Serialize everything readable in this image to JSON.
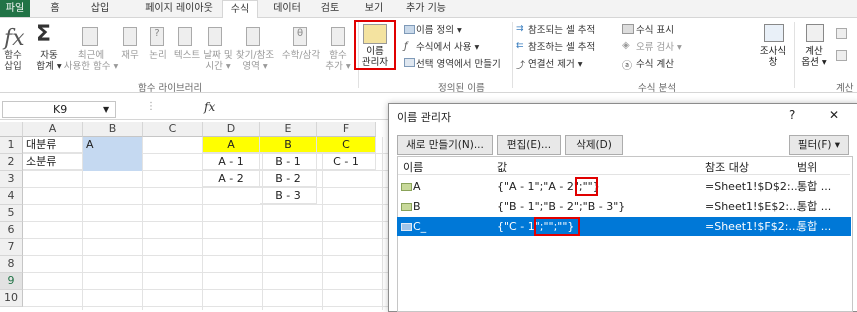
{
  "menu": {
    "tabs": [
      "파일",
      "홈",
      "삽입",
      "페이지 레이아웃",
      "수식",
      "데이터",
      "검토",
      "보기",
      "추가 기능"
    ]
  },
  "ribbon": {
    "insert_function": "함수\n삽입",
    "autosum": "자동\n합계 ▾",
    "recent": "최근에\n사용한 함수 ▾",
    "financial": "재무",
    "logical": "논리",
    "text": "텍스트",
    "datetime": "날짜 및\n시간 ▾",
    "lookup": "찾기/참조\n영역 ▾",
    "math": "수학/삼각",
    "more": "함수\n추가 ▾",
    "group_library": "함수 라이브러리",
    "name_manager": "이름\n관리자",
    "define_name": "이름 정의 ▾",
    "use_in_formula": "수식에서 사용 ▾",
    "create_from_selection": "선택 영역에서 만들기",
    "group_defined_names": "정의된 이름",
    "trace_precedents": "참조되는 셀 추적",
    "trace_dependents": "참조하는 셀 추적",
    "remove_arrows": "연결선 제거 ▾",
    "show_formulas": "수식 표시",
    "error_checking": "오류 검사 ▾",
    "evaluate_formula": "수식 계산",
    "watch_window": "조사식\n창",
    "group_auditing": "수식 분석",
    "calc_options": "계산\n옵션 ▾",
    "group_calc": "계산"
  },
  "formula_bar": {
    "name_box": "K9",
    "fx": "fx"
  },
  "sheet": {
    "columns": [
      "A",
      "B",
      "C",
      "D",
      "E",
      "F"
    ],
    "rows": [
      "1",
      "2",
      "3",
      "4",
      "5",
      "6",
      "7",
      "8",
      "9",
      "10"
    ],
    "cells": {
      "A1": "대분류",
      "B1": "A",
      "D1": "A",
      "E1": "B",
      "F1": "C",
      "A2": "소분류",
      "D2": "A - 1",
      "E2": "B - 1",
      "F2": "C - 1",
      "D3": "A - 2",
      "E3": "B - 2",
      "E4": "B - 3"
    }
  },
  "dialog": {
    "title": "이름 관리자",
    "help": "?",
    "close": "✕",
    "new_button": "새로 만들기(N)...",
    "edit_button": "편집(E)...",
    "delete_button": "삭제(D)",
    "filter_button": "필터(F) ▾",
    "columns": [
      "이름",
      "값",
      "참조 대상",
      "범위"
    ],
    "rows": [
      {
        "name": "A",
        "value_prefix": "{\"A - 1\";\"A - 2",
        "value_highlight": "\";\"\"",
        "value_suffix": "}",
        "refers_to": "=Sheet1!$D$2:...",
        "scope": "통합 ..."
      },
      {
        "name": "B",
        "value_prefix": "{\"B - 1\";\"B - 2\";\"B - 3\"}",
        "value_highlight": "",
        "value_suffix": "",
        "refers_to": "=Sheet1!$E$2:...",
        "scope": "통합 ..."
      },
      {
        "name": "C_",
        "value_prefix": "{\"C - 1",
        "value_highlight": "\";\"\";\"\"",
        "value_suffix": "}",
        "refers_to": "=Sheet1!$F$2:...",
        "scope": "통합 ..."
      }
    ]
  },
  "colors": {
    "excel_green": "#217346",
    "highlight_yellow": "#ffff00",
    "selection_blue": "#0078d7",
    "annotation_red": "#e00000"
  }
}
